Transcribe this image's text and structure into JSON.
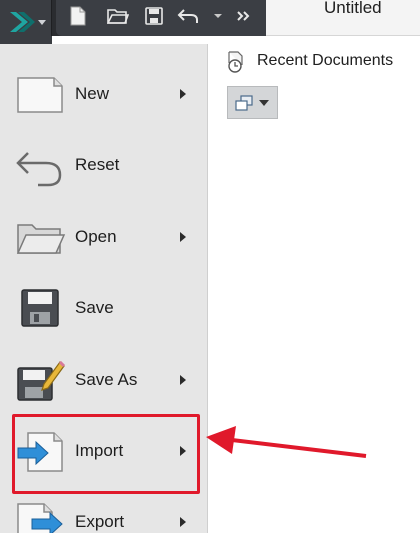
{
  "window": {
    "title": "Untitled"
  },
  "app_button": {
    "icon": "autodesk-logo-icon"
  },
  "quick_access": [
    {
      "icon": "new-file-icon"
    },
    {
      "icon": "open-folder-icon"
    },
    {
      "icon": "save-icon"
    },
    {
      "icon": "undo-icon"
    },
    {
      "icon": "dropdown-icon"
    },
    {
      "icon": "more-icon"
    }
  ],
  "menu": {
    "items": [
      {
        "label": "New",
        "has_submenu": true,
        "icon": "new-document-icon"
      },
      {
        "label": "Reset",
        "has_submenu": false,
        "icon": "reset-icon"
      },
      {
        "label": "Open",
        "has_submenu": true,
        "icon": "open-folder-icon"
      },
      {
        "label": "Save",
        "has_submenu": false,
        "icon": "save-icon"
      },
      {
        "label": "Save As",
        "has_submenu": true,
        "icon": "save-as-icon"
      },
      {
        "label": "Import",
        "has_submenu": true,
        "icon": "import-icon",
        "highlighted": true
      },
      {
        "label": "Export",
        "has_submenu": true,
        "icon": "export-icon"
      }
    ]
  },
  "recent": {
    "label": "Recent Documents",
    "icon": "recent-documents-icon",
    "view_icon": "view-options-icon"
  },
  "colors": {
    "highlight": "#e0192b",
    "menu_background": "#e6e6e6",
    "toolbar": "#2a2c30",
    "import_arrow": "#2f8fd8"
  }
}
